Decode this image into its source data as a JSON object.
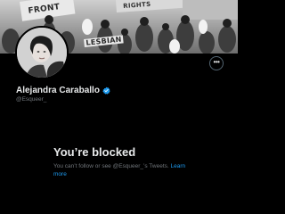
{
  "banner": {
    "signs": [
      "FRONT",
      "LESBIAN",
      "RIGHTS"
    ]
  },
  "profile": {
    "display_name": "Alejandra Caraballo",
    "handle": "@Esqueer_",
    "more_label": "•••",
    "verified": true
  },
  "blocked": {
    "title": "You’re blocked",
    "message": "You can’t follow or see @Esqueer_’s Tweets.",
    "link_label": "Learn more"
  },
  "colors": {
    "background": "#000000",
    "text_primary": "#e7e9ea",
    "text_secondary": "#71767b",
    "accent": "#1d9bf0"
  }
}
